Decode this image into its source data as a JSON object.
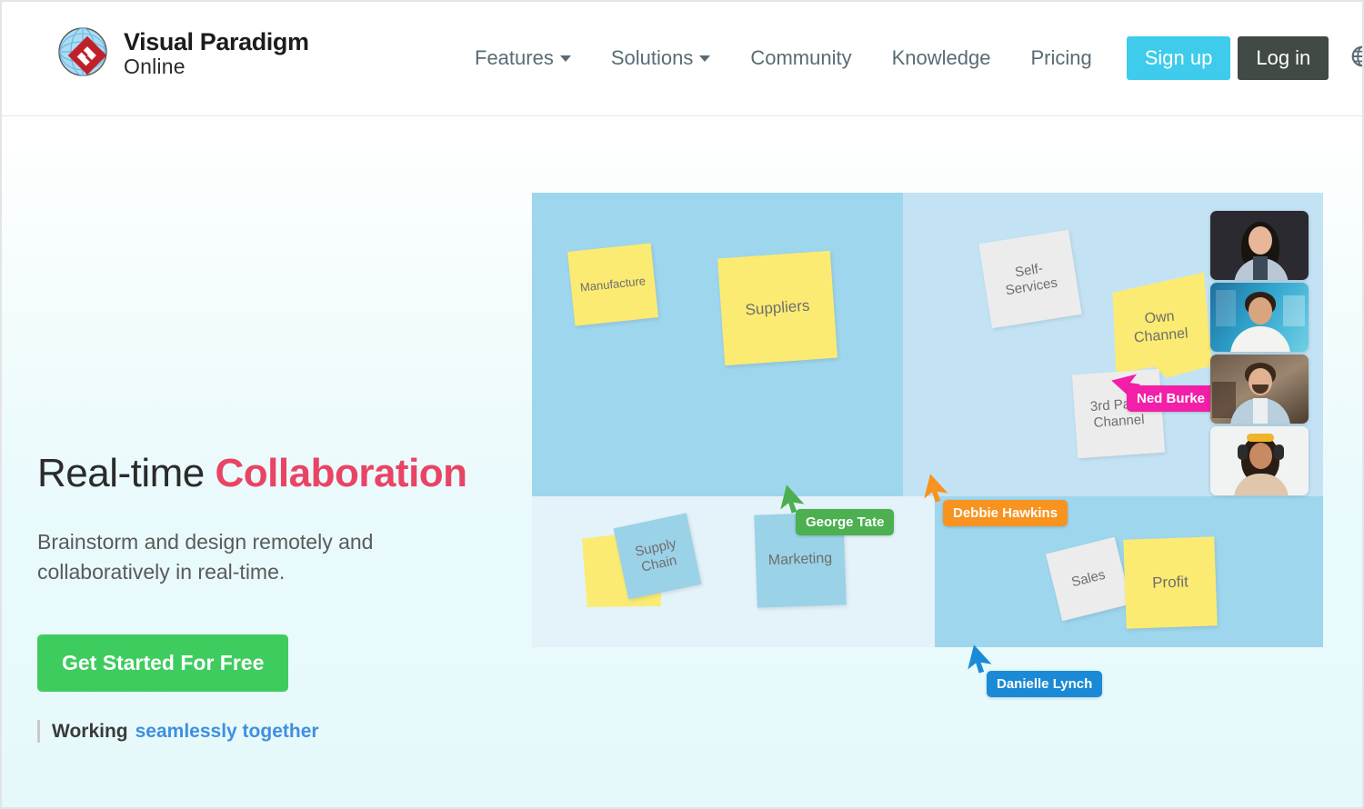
{
  "brand": {
    "name_line1": "Visual Paradigm",
    "name_line2": "Online",
    "logo_icon": "globe-diamond-logo"
  },
  "header": {
    "nav": [
      {
        "label": "Features",
        "has_caret": true,
        "name": "nav-features"
      },
      {
        "label": "Solutions",
        "has_caret": true,
        "name": "nav-solutions"
      },
      {
        "label": "Community",
        "has_caret": false,
        "name": "nav-community"
      },
      {
        "label": "Knowledge",
        "has_caret": false,
        "name": "nav-knowledge"
      },
      {
        "label": "Pricing",
        "has_caret": false,
        "name": "nav-pricing"
      }
    ],
    "signup_label": "Sign up",
    "login_label": "Log in",
    "language_icon": "globe-icon",
    "language_caret_icon": "chevron-down-icon",
    "signup_color": "#3fcbeb",
    "login_color": "#414a44"
  },
  "hero": {
    "headline_plain": "Real-time ",
    "headline_accent": "Collaboration",
    "subhead": "Brainstorm and design remotely and collaboratively in real-time.",
    "cta_label": "Get Started For Free",
    "cta_color": "#3ecc5f",
    "tagline_strong": "Working",
    "tagline_link": "seamlessly together",
    "accent_color": "#e94464",
    "link_color": "#3f8fe0"
  },
  "board": {
    "quadrants": [
      {
        "name": "quadrant-top-left",
        "color": "#9ed6ed"
      },
      {
        "name": "quadrant-top-right",
        "color": "#c3e3f5"
      },
      {
        "name": "quadrant-bottom-left",
        "color": "#e4f2f9"
      },
      {
        "name": "quadrant-bottom-right",
        "color": "#9ed6ed"
      }
    ],
    "notes": [
      {
        "text": "Manufacture",
        "color": "yellow",
        "name": "sticky-note-manufacture"
      },
      {
        "text": "Suppliers",
        "color": "yellow",
        "name": "sticky-note-suppliers"
      },
      {
        "text": "Self-Services",
        "color": "grey",
        "name": "sticky-note-self-services"
      },
      {
        "text": "Own Channel",
        "color": "yellow",
        "name": "sticky-note-own-channel"
      },
      {
        "text": "3rd Party Channel",
        "color": "grey",
        "name": "sticky-note-3rd-party-channel"
      },
      {
        "text": "Supply Chain",
        "color": "blue",
        "name": "sticky-note-supply-chain"
      },
      {
        "text": "Marketing",
        "color": "blue",
        "name": "sticky-note-marketing"
      },
      {
        "text": "Sales",
        "color": "grey",
        "name": "sticky-note-sales"
      },
      {
        "text": "Profit",
        "color": "yellow",
        "name": "sticky-note-profit"
      },
      {
        "text": "",
        "color": "yellow",
        "name": "sticky-note-blank-yellow"
      }
    ],
    "cursors": [
      {
        "label": "Ned Burke",
        "color": "#f41fa8",
        "name": "collab-cursor-ned-burke"
      },
      {
        "label": "George Tate",
        "color": "#4caf50",
        "name": "collab-cursor-george-tate"
      },
      {
        "label": "Debbie Hawkins",
        "color": "#f7931e",
        "name": "collab-cursor-debbie-hawkins"
      },
      {
        "label": "Danielle Lynch",
        "color": "#1b8ad6",
        "name": "collab-cursor-danielle-lynch"
      }
    ],
    "video_tiles": [
      {
        "name": "video-tile-participant-1",
        "description": "woman-dark-background"
      },
      {
        "name": "video-tile-participant-2",
        "description": "man-blue-office"
      },
      {
        "name": "video-tile-participant-3",
        "description": "man-bearded-cafe"
      },
      {
        "name": "video-tile-participant-4",
        "description": "woman-headset"
      }
    ]
  }
}
